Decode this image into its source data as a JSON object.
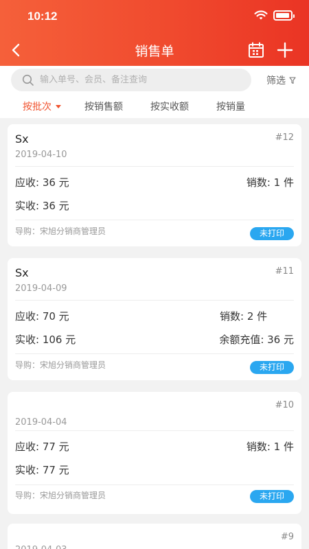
{
  "status_bar": {
    "time": "10:12"
  },
  "nav": {
    "title": "销售单"
  },
  "search": {
    "placeholder": "输入单号、会员、备注查询"
  },
  "filter": {
    "label": "筛选"
  },
  "tabs": [
    {
      "label": "按批次"
    },
    {
      "label": "按销售额"
    },
    {
      "label": "按实收额"
    },
    {
      "label": "按销量"
    }
  ],
  "orders": [
    {
      "title": "Sx",
      "number": "#12",
      "date": "2019-04-10",
      "receivable": "应收: 36 元",
      "sales_count": "销数: 1 件",
      "received": "实收: 36 元",
      "balance_topup": "",
      "guide": "导购：宋旭分销商管理员",
      "print_status": "未打印"
    },
    {
      "title": "Sx",
      "number": "#11",
      "date": "2019-04-09",
      "receivable": "应收: 70 元",
      "sales_count": "销数: 2 件",
      "received": "实收: 106 元",
      "balance_topup": "余额充值: 36 元",
      "guide": "导购：宋旭分销商管理员",
      "print_status": "未打印"
    },
    {
      "title": "",
      "number": "#10",
      "date": "2019-04-04",
      "receivable": "应收: 77 元",
      "sales_count": "销数: 1 件",
      "received": "实收: 77 元",
      "balance_topup": "",
      "guide": "导购：宋旭分销商管理员",
      "print_status": "未打印"
    },
    {
      "title": "",
      "number": "#9",
      "date": "2019-04-03"
    }
  ],
  "colors": {
    "header_start": "#f5603a",
    "header_end": "#ea3424",
    "accent": "#f0522e",
    "badge": "#2aa7f0"
  },
  "icons": {
    "back": "chevron-left-icon",
    "calendar": "calendar-icon",
    "add": "plus-icon",
    "search": "search-icon",
    "filter": "funnel-icon",
    "wifi": "wifi-icon",
    "battery": "battery-icon"
  }
}
